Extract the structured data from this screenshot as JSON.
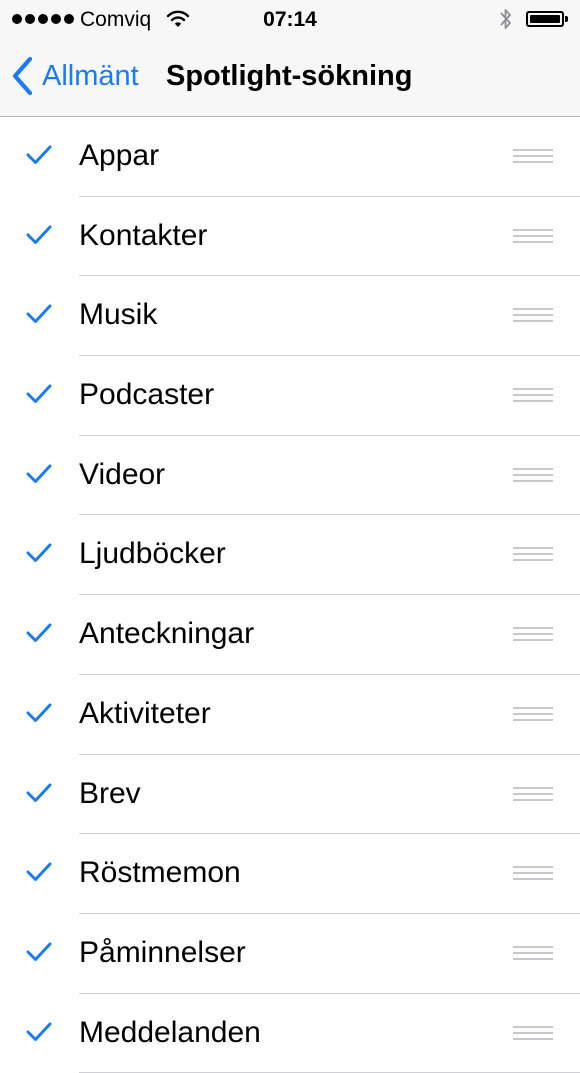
{
  "status_bar": {
    "carrier": "Comviq",
    "time": "07:14",
    "signal_dots": 5,
    "battery_level": 1.0
  },
  "nav": {
    "back_label": "Allmänt",
    "title": "Spotlight-sökning"
  },
  "colors": {
    "accent": "#1a7cf0",
    "separator": "#cfcfd2",
    "bar_background": "#f7f7f8"
  },
  "items": [
    {
      "label": "Appar",
      "checked": true
    },
    {
      "label": "Kontakter",
      "checked": true
    },
    {
      "label": "Musik",
      "checked": true
    },
    {
      "label": "Podcaster",
      "checked": true
    },
    {
      "label": "Videor",
      "checked": true
    },
    {
      "label": "Ljudböcker",
      "checked": true
    },
    {
      "label": "Anteckningar",
      "checked": true
    },
    {
      "label": "Aktiviteter",
      "checked": true
    },
    {
      "label": "Brev",
      "checked": true
    },
    {
      "label": "Röstmemon",
      "checked": true
    },
    {
      "label": "Påminnelser",
      "checked": true
    },
    {
      "label": "Meddelanden",
      "checked": true
    }
  ]
}
